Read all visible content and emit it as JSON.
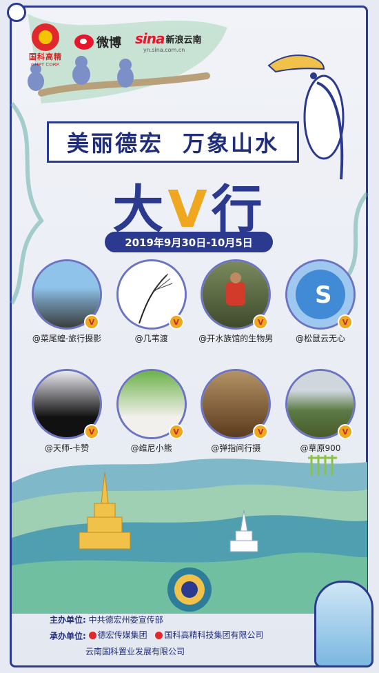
{
  "logos": {
    "ghpt_name": "国科高精",
    "ghpt_en": "GHPT CORP.",
    "weibo": "微博",
    "sina": "sina",
    "sina_cn": "新浪云南",
    "sina_url": "yn.sina.com.cn"
  },
  "banner": {
    "left": "美丽德宏",
    "right": "万象山水"
  },
  "big_title": {
    "part1": "大",
    "part2": "V",
    "part3": "行"
  },
  "date": "2019年9月30日-10月5日",
  "influencers": [
    {
      "name": "@菜尾蝗-旅行摄影",
      "badge": "V"
    },
    {
      "name": "@几苇渡",
      "badge": "V"
    },
    {
      "name": "@开水族馆的生物男",
      "badge": "V"
    },
    {
      "name": "@松鼠云无心",
      "badge": "V"
    },
    {
      "name": "@天师-卡赞",
      "badge": "V"
    },
    {
      "name": "@维尼小熊",
      "badge": "V"
    },
    {
      "name": "@弹指间行摄",
      "badge": "V"
    },
    {
      "name": "@草原900",
      "badge": "V"
    }
  ],
  "footer": {
    "host_label": "主办单位:",
    "host": "中共德宏州委宣传部",
    "organizer_label": "承办单位:",
    "org1": "德宏传媒集团",
    "org2": "国科高精科技集团有限公司",
    "org3": "云南国科置业发展有限公司"
  },
  "colors": {
    "frame": "#2b3a8e",
    "accent": "#f0a720",
    "weibo_red": "#e6162d"
  }
}
